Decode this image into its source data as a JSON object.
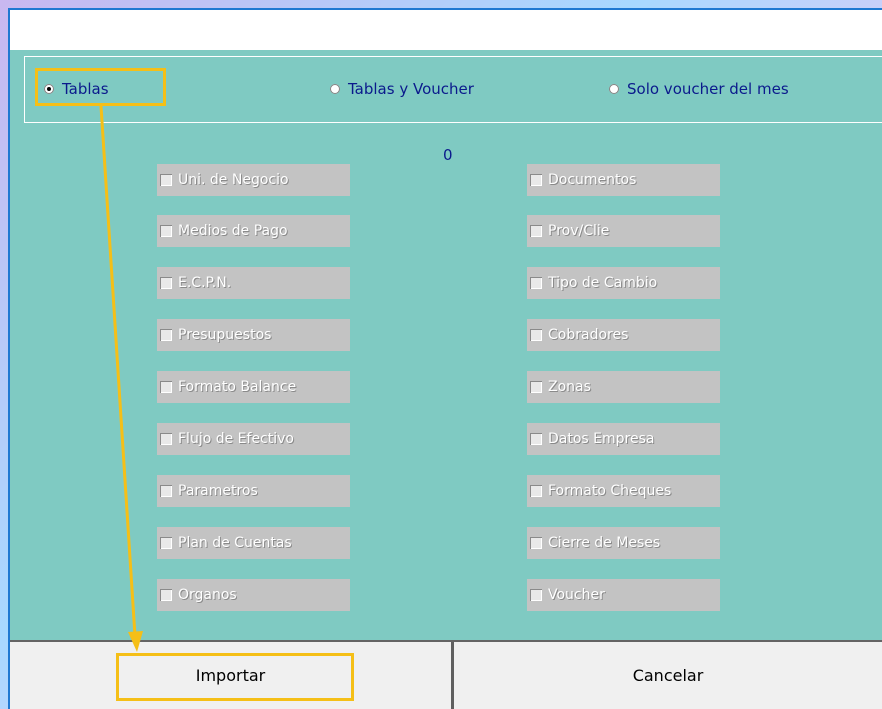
{
  "options": {
    "selected": "Tablas",
    "tablas": "Tablas",
    "tablas_voucher": "Tablas y Voucher",
    "solo_voucher": "Solo voucher del mes"
  },
  "counter": "0",
  "left_checks": [
    "Uni. de Negocio",
    "Medios de Pago",
    "E.C.P.N.",
    "Presupuestos",
    "Formato Balance",
    "Flujo de Efectivo",
    "Parametros",
    "Plan de Cuentas",
    "Organos"
  ],
  "right_checks": [
    "Documentos",
    "Prov/Clie",
    "Tipo de Cambio",
    "Cobradores",
    "Zonas",
    "Datos Empresa",
    "Formato Cheques",
    "Cierre de Meses",
    "Voucher"
  ],
  "buttons": {
    "importar": "Importar",
    "cancelar": "Cancelar"
  },
  "colors": {
    "panel": "#7fcac2",
    "highlight": "#f5bf17",
    "label_blue": "#0b1a8c"
  }
}
